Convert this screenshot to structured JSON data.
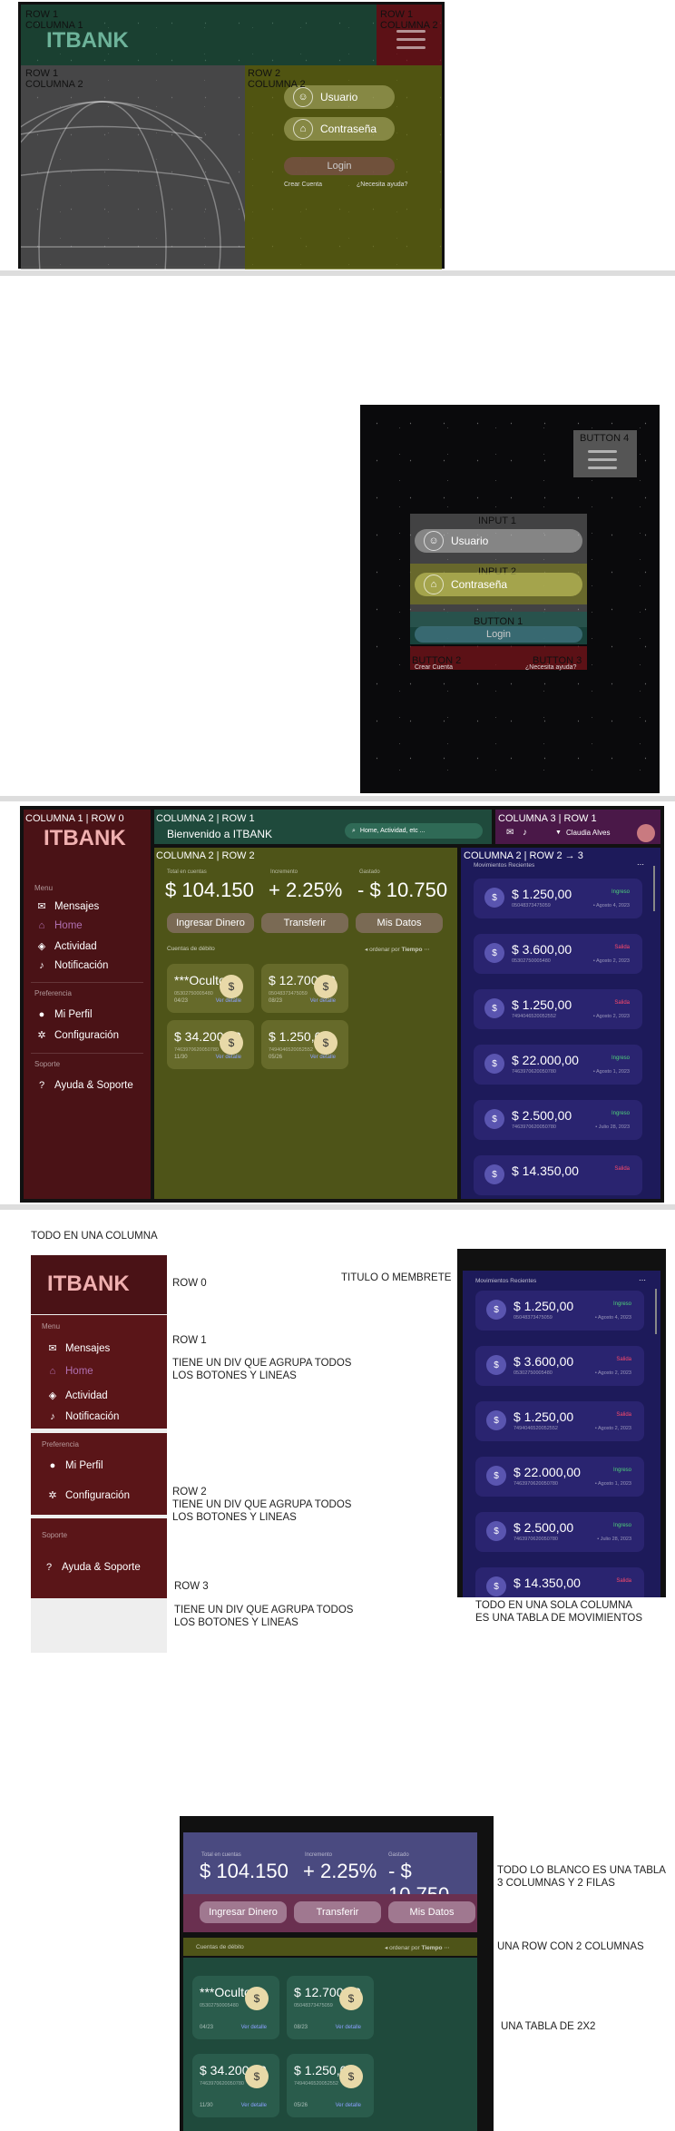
{
  "colors": {
    "green": "#1f4a3c",
    "maroon": "#5a1518",
    "olive": "#4e5418",
    "navy": "#1d1a5a",
    "purple": "#4a1848"
  },
  "brand": "ITBANK",
  "s1": {
    "row1col1": "ROW 1\nCOLUMNA 1",
    "row1col2": "ROW 1\nCOLUMNA 2",
    "row2col1": "ROW 1\nCOLUMNA 2",
    "row2col2": "ROW 2\nCOLUMNA 2",
    "user": "Usuario",
    "pass": "Contraseña",
    "login": "Login",
    "create": "Crear Cuenta",
    "help": "¿Necesita ayuda?"
  },
  "s2": {
    "button4": "BUTTON 4",
    "input1": "INPUT 1",
    "input2": "INPUT 2",
    "button1": "BUTTON 1",
    "button2": "BUTTON 2",
    "button3": "BUTTON 3",
    "user": "Usuario",
    "pass": "Contraseña",
    "login": "Login",
    "create": "Crear Cuenta",
    "help": "¿Necesita ayuda?"
  },
  "s3": {
    "c1r0": "COLUMNA 1 | ROW 0",
    "c2r1": "COLUMNA 2 | ROW 1",
    "c3r1": "COLUMNA 3 | ROW 1",
    "c2r2": "COLUMNA 2 | ROW 2",
    "c2r23": "COLUMNA 2 | ROW 2 → 3",
    "welcome": "Bienvenido a ITBANK",
    "search": "Home, Actividad, etc ...",
    "user": "Claudia Alves"
  },
  "menu": {
    "menu": "Menu",
    "mensajes": "Mensajes",
    "home": "Home",
    "actividad": "Actividad",
    "notif": "Notificación",
    "pref": "Preferencia",
    "perfil": "Mi Perfil",
    "config": "Configuración",
    "soporte": "Soporte",
    "ayuda": "Ayuda & Soporte"
  },
  "dash": {
    "total_lbl": "Total en cuentas",
    "total": "$ 104.150",
    "inc_lbl": "Incremento",
    "inc": "+ 2.25%",
    "gas_lbl": "Gastado",
    "gas": "- $ 10.750",
    "b1": "Ingresar Dinero",
    "b2": "Transferir",
    "b3": "Mis Datos",
    "cuentas": "Cuentas de débito",
    "orden": "ordenar por",
    "tiempo": "Tiempo",
    "ver": "Ver detalle"
  },
  "cards": [
    {
      "v": "***Oculto",
      "n": "05302750005480",
      "d": "04/23"
    },
    {
      "v": "$ 12.700,00",
      "n": "05048373475059",
      "d": "08/23"
    },
    {
      "v": "$ 34.200,00",
      "n": "7463970620050780",
      "d": "11/30"
    },
    {
      "v": "$ 1.250,00",
      "n": "7494046520052552",
      "d": "05/26"
    }
  ],
  "movs_title": "Movimientos Recientes",
  "movs": [
    {
      "a": "$ 1.250,00",
      "n": "05048373475059",
      "t": "Ingreso",
      "d": "• Agosto 4, 2023",
      "c": "#4fd17a"
    },
    {
      "a": "$ 3.600,00",
      "n": "05302750005480",
      "t": "Salida",
      "d": "• Agosto 2, 2023",
      "c": "#ff4a6a"
    },
    {
      "a": "$ 1.250,00",
      "n": "7494046520052552",
      "t": "Salida",
      "d": "• Agosto 2, 2023",
      "c": "#ff4a6a"
    },
    {
      "a": "$ 22.000,00",
      "n": "7463970620050780",
      "t": "Ingreso",
      "d": "• Agosto 1, 2023",
      "c": "#4fd17a"
    },
    {
      "a": "$ 2.500,00",
      "n": "7463970620050780",
      "t": "Ingreso",
      "d": "• Julio 28, 2023",
      "c": "#4fd17a"
    },
    {
      "a": "$ 14.350,00",
      "n": "",
      "t": "Salida",
      "d": "",
      "c": "#ff4a6a"
    }
  ],
  "notes": {
    "col": "TODO EN UNA COLUMNA",
    "row0": "ROW 0",
    "titulo": "TITULO O MEMBRETE",
    "row1": "ROW 1",
    "row1b": "TIENE UN DIV QUE AGRUPA TODOS\nLOS BOTONES Y LINEAS",
    "row2": "ROW 2\nTIENE UN DIV QUE AGRUPA TODOS\nLOS BOTONES Y LINEAS",
    "row3": "ROW 3",
    "row3b": "TIENE UN DIV QUE AGRUPA TODOS\nLOS BOTONES Y LINEAS",
    "movcol": "TODO EN UNA SOLA COLUMNA\nES UNA TABLA DE MOVIMIENTOS",
    "tabla": "TODO LO BLANCO ES UNA TABLA\n3 COLUMNAS Y 2 FILAS",
    "row2col": "UNA ROW CON 2 COLUMNAS",
    "tabla22": "UNA TABLA DE 2X2"
  }
}
